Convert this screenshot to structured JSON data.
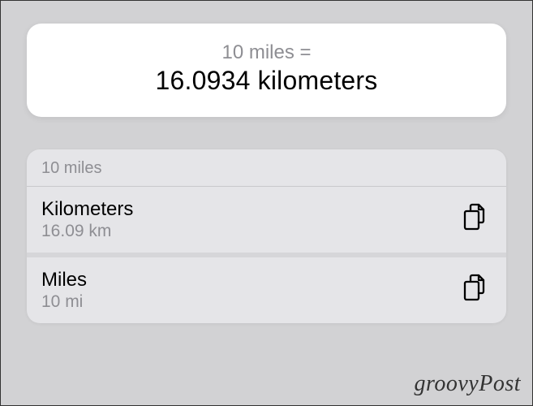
{
  "hero": {
    "query": "10 miles =",
    "result": "16.0934 kilometers"
  },
  "list": {
    "header": "10 miles",
    "rows": [
      {
        "title": "Kilometers",
        "sub": "16.09 km"
      },
      {
        "title": "Miles",
        "sub": "10 mi"
      }
    ]
  },
  "watermark": "groovyPost"
}
